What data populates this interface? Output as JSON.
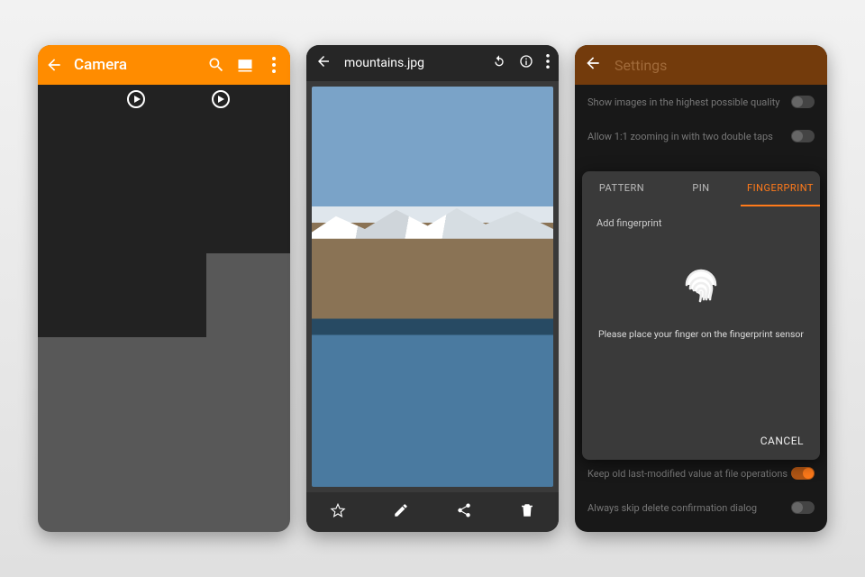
{
  "screen1": {
    "title": "Camera",
    "icons": {
      "back": "←",
      "search": "search",
      "slideshow": "slideshow",
      "more": "⋮"
    },
    "thumbs": [
      {
        "kind": "photo"
      },
      {
        "kind": "video"
      },
      {
        "kind": "video"
      },
      {
        "kind": "photo"
      },
      {
        "kind": "photo"
      },
      {
        "kind": "photo"
      },
      {
        "kind": "photo"
      },
      {
        "kind": "photo"
      },
      {
        "kind": "empty"
      }
    ]
  },
  "screen2": {
    "filename": "mountains.jpg",
    "top_icons": {
      "back": "←",
      "rotate": "↻",
      "info": "ⓘ",
      "more": "⋮"
    },
    "bottom_icons": {
      "favorite": "☆",
      "edit": "✎",
      "share": "share",
      "delete": "🗑"
    }
  },
  "screen3": {
    "title": "Settings",
    "rows": [
      {
        "label": "Show images in the highest possible quality",
        "on": false
      },
      {
        "label": "Allow 1:1 zooming in with two double taps",
        "on": false
      },
      {
        "label": "Keep old last-modified value at file operations",
        "on": true
      },
      {
        "label": "Always skip delete confirmation dialog",
        "on": false
      }
    ],
    "sheet": {
      "tabs": [
        "PATTERN",
        "PIN",
        "FINGERPRINT"
      ],
      "active_tab": 2,
      "add_label": "Add fingerprint",
      "hint": "Please place your finger on the fingerprint sensor",
      "cancel": "CANCEL"
    }
  }
}
